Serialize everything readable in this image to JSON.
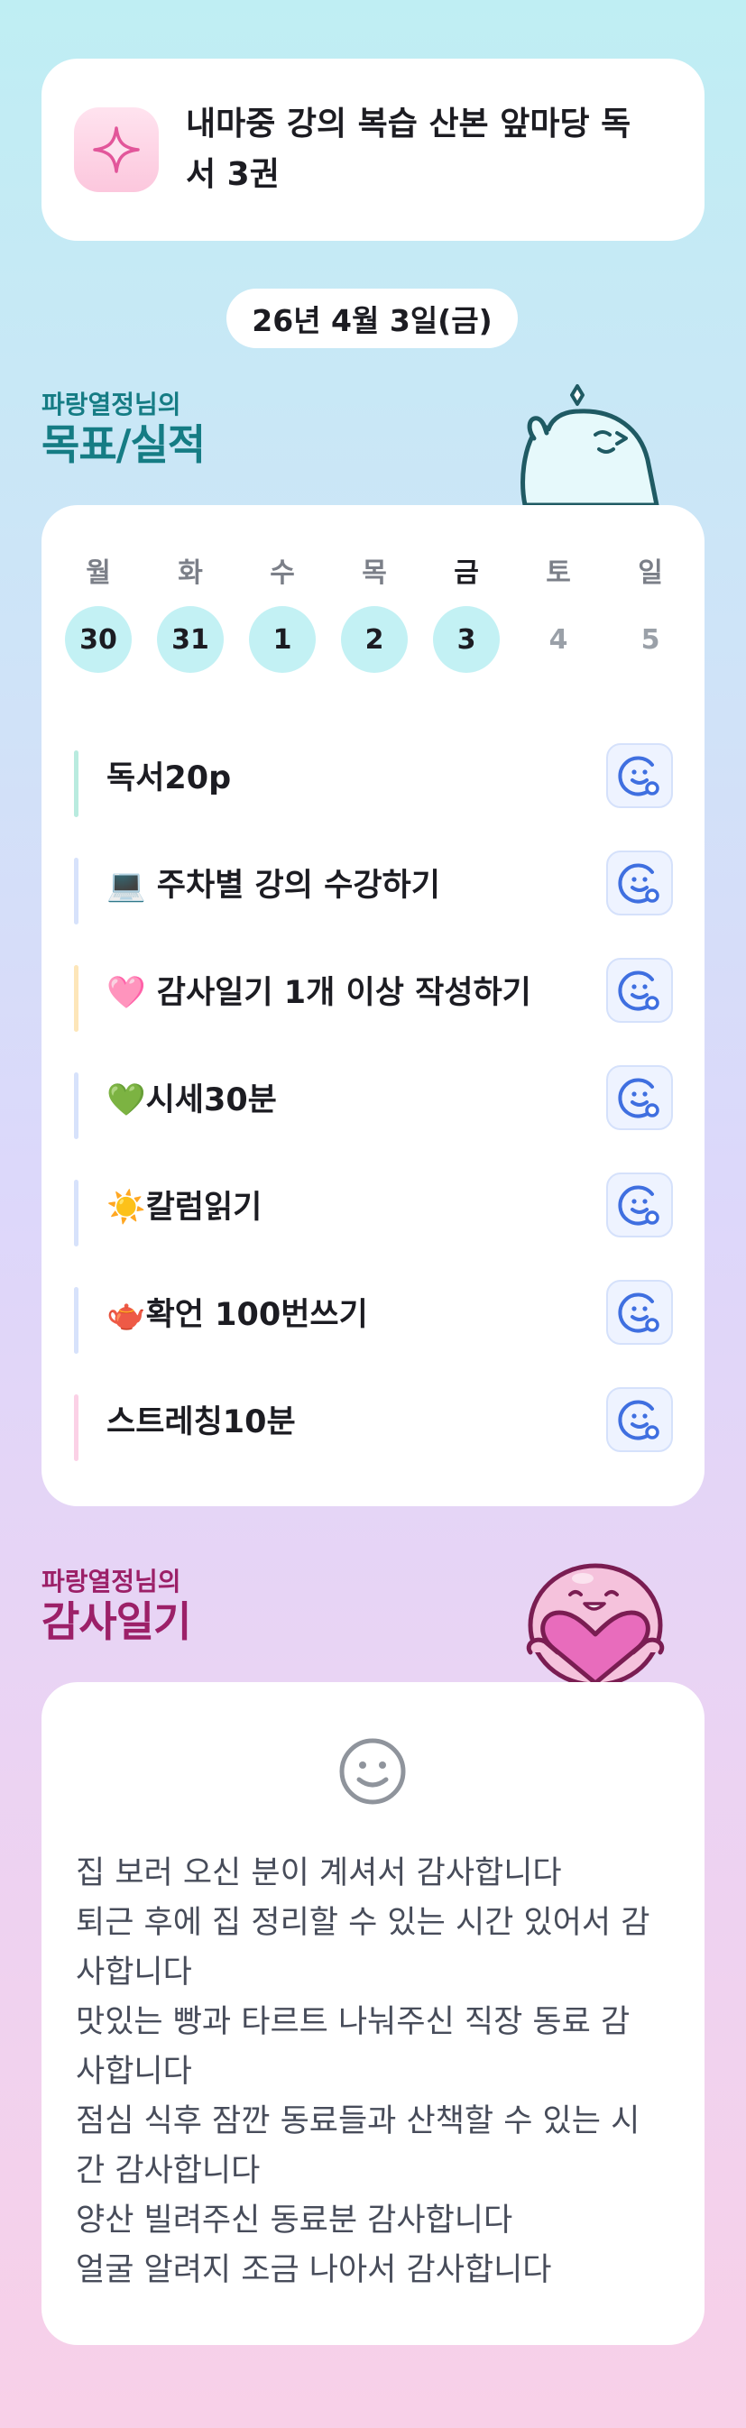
{
  "goal": {
    "text": "내마중 강의 복습 산본 앞마당 독서 3권",
    "icon": "sparkle-icon"
  },
  "date": "26년 4월 3일(금)",
  "goals_section": {
    "subtitle": "파랑열정님의",
    "title": "목표/실적"
  },
  "week": [
    {
      "label": "월",
      "num": "30",
      "state": "filled"
    },
    {
      "label": "화",
      "num": "31",
      "state": "filled"
    },
    {
      "label": "수",
      "num": "1",
      "state": "filled"
    },
    {
      "label": "목",
      "num": "2",
      "state": "filled"
    },
    {
      "label": "금",
      "num": "3",
      "state": "today"
    },
    {
      "label": "토",
      "num": "4",
      "state": "empty"
    },
    {
      "label": "일",
      "num": "5",
      "state": "empty"
    }
  ],
  "tasks": [
    {
      "label": "독서20p",
      "bar_color": "#b9ebdf"
    },
    {
      "label": "💻 주차별 강의 수강하기",
      "bar_color": "#d7e2fb"
    },
    {
      "label": "🩷 감사일기 1개 이상 작성하기",
      "bar_color": "#fde6b9"
    },
    {
      "label": "💚시세30분",
      "bar_color": "#d7e2fb"
    },
    {
      "label": "☀️칼럼읽기",
      "bar_color": "#d7e2fb"
    },
    {
      "label": "🫖확언 100번쓰기",
      "bar_color": "#d7e2fb"
    },
    {
      "label": "스트레칭10분",
      "bar_color": "#fbd1e6"
    }
  ],
  "gratitude_section": {
    "subtitle": "파랑열정님의",
    "title": "감사일기"
  },
  "gratitude": [
    "집 보러 오신 분이 계셔서 감사합니다",
    "퇴근 후에 집 정리할 수 있는 시간 있어서 감",
    "사합니다",
    "맛있는 빵과 타르트 나눠주신 직장 동료 감",
    "사합니다",
    "점심 식후 잠깐 동료들과 산책할 수 있는 시",
    "간 감사합니다",
    "양산 빌려주신 동료분 감사합니다",
    "얼굴 알려지 조금 나아서 감사합니다"
  ],
  "colors": {
    "goals_heading": "#157c84",
    "gratitude_heading": "#9c2068",
    "day_filled": "#c3f1f4",
    "task_button_icon": "#3f6fe0"
  }
}
